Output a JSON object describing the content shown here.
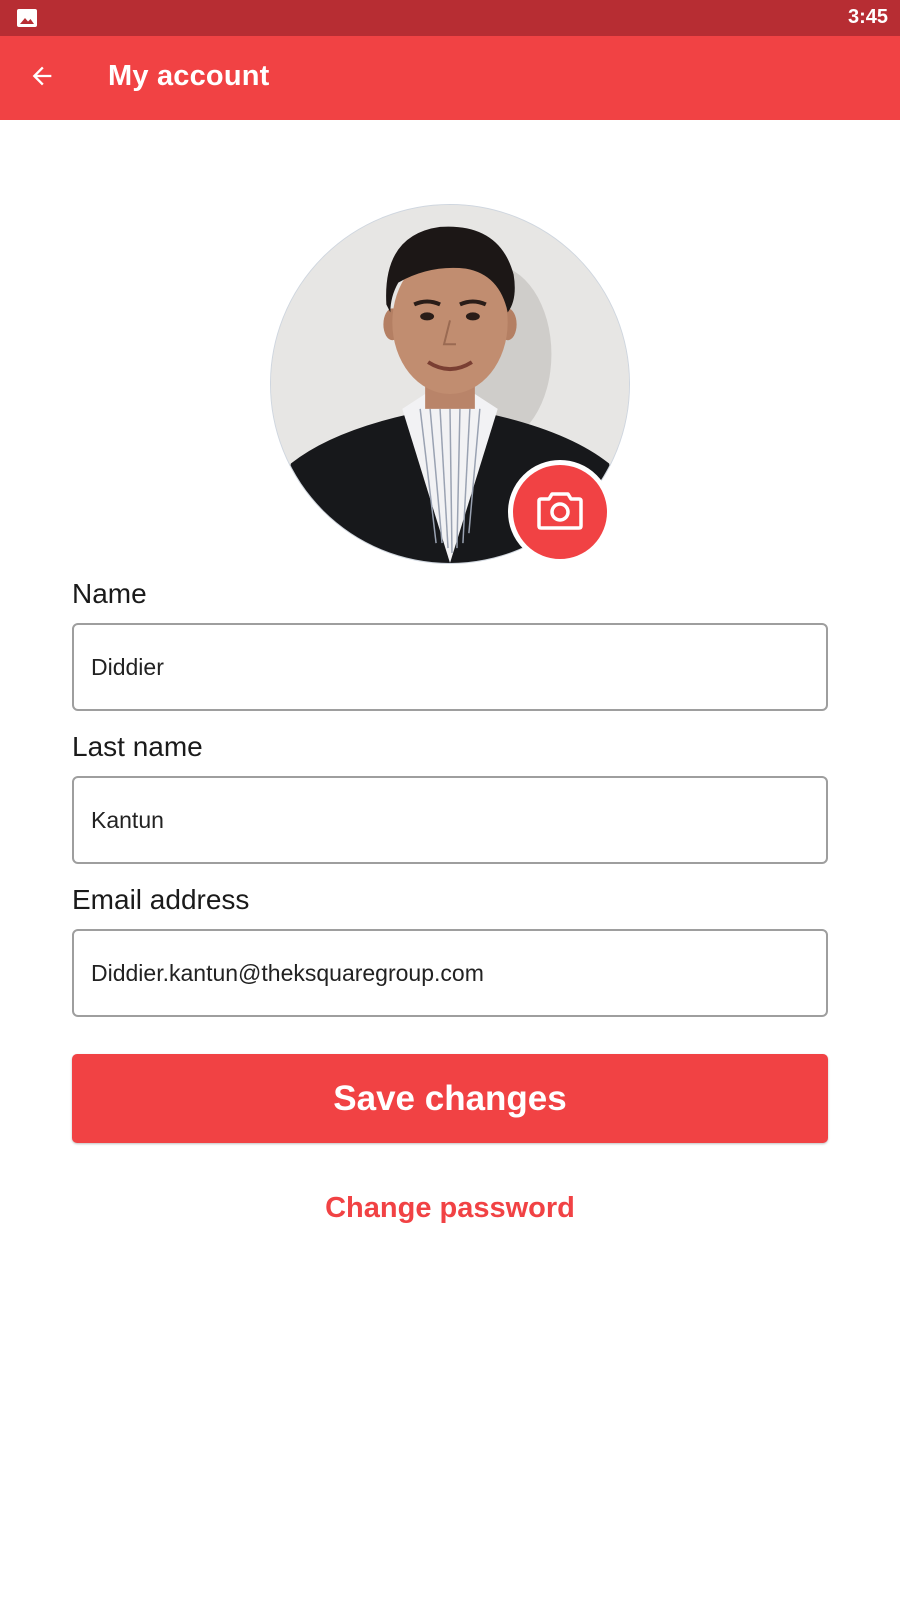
{
  "status_bar": {
    "time": "3:45",
    "notification_icon": "image-icon"
  },
  "app_bar": {
    "back_icon": "arrow-back-icon",
    "title": "My account"
  },
  "profile": {
    "photo": "profile-photo",
    "camera_icon": "camera-icon"
  },
  "form": {
    "name_label": "Name",
    "name_value": "Diddier",
    "last_name_label": "Last name",
    "last_name_value": "Kantun",
    "email_label": "Email address",
    "email_value": "Diddier.kantun@theksquaregroup.com"
  },
  "actions": {
    "save_label": "Save changes",
    "change_password_label": "Change password"
  },
  "colors": {
    "status_bar": "#b72d33",
    "accent": "#f14244",
    "background": "#ffffff"
  }
}
